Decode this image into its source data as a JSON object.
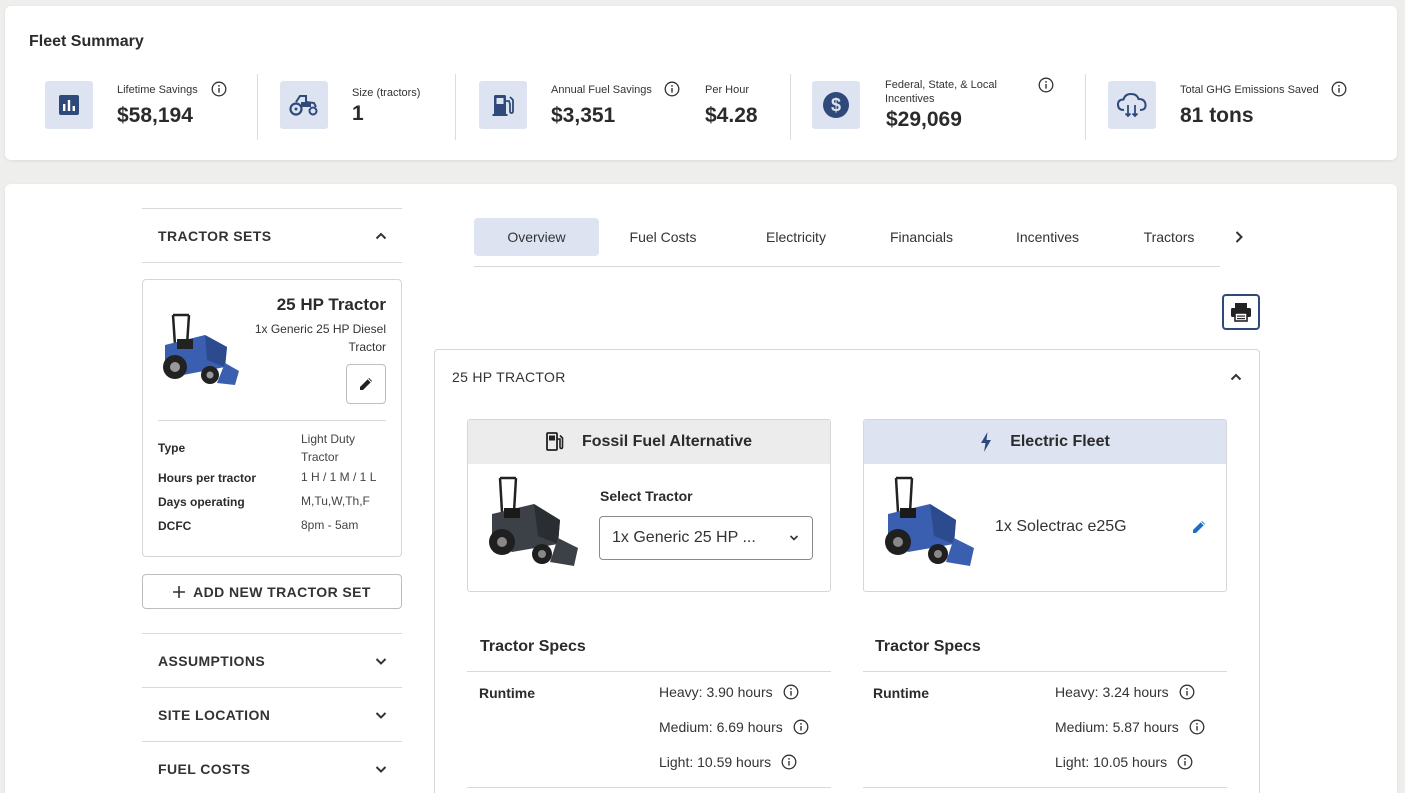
{
  "summary": {
    "title": "Fleet Summary",
    "lifetime_label": "Lifetime Savings",
    "lifetime_value": "$58,194",
    "size_label": "Size (tractors)",
    "size_value": "1",
    "annual_label": "Annual Fuel Savings",
    "annual_value": "$3,351",
    "hour_label": "Per Hour",
    "hour_value": "$4.28",
    "incent_label": "Federal, State, & Local Incentives",
    "incent_value": "$29,069",
    "ghg_label": "Total GHG Emissions Saved",
    "ghg_value": "81 tons"
  },
  "sidebar": {
    "tractor_sets": "TRACTOR SETS",
    "assumptions": "ASSUMPTIONS",
    "site_location": "SITE LOCATION",
    "fuel_costs": "FUEL COSTS",
    "add_label": "ADD NEW TRACTOR SET",
    "card": {
      "title": "25 HP Tractor",
      "subtitle": "1x Generic 25 HP Diesel Tractor",
      "specs": [
        {
          "key": "Type",
          "value": "Light Duty Tractor"
        },
        {
          "key": "Hours per tractor",
          "value": "1 H / 1 M / 1 L"
        },
        {
          "key": "Days operating",
          "value": "M,Tu,W,Th,F"
        },
        {
          "key": "DCFC",
          "value": "8pm - 5am"
        }
      ]
    }
  },
  "tabs": [
    "Overview",
    "Fuel Costs",
    "Electricity",
    "Financials",
    "Incentives",
    "Tractors"
  ],
  "panel": {
    "title": "25 HP TRACTOR",
    "fossil": {
      "heading": "Fossil Fuel Alternative",
      "select_label": "Select Tractor",
      "select_value": "1x Generic 25 HP ..."
    },
    "electric": {
      "heading": "Electric Fleet",
      "model": "1x Solectrac e25G"
    },
    "specs_title": "Tractor Specs",
    "runtime_label": "Runtime",
    "fossil_runtime": [
      "Heavy: 3.90 hours",
      "Medium: 6.69 hours",
      "Light: 10.59 hours"
    ],
    "electric_runtime": [
      "Heavy: 3.24 hours",
      "Medium: 5.87 hours",
      "Light: 10.05 hours"
    ]
  },
  "colors": {
    "accent_bg": "#dde3f0",
    "navy": "#2f4a7a",
    "tractor_blue": "#3a5fb0"
  }
}
